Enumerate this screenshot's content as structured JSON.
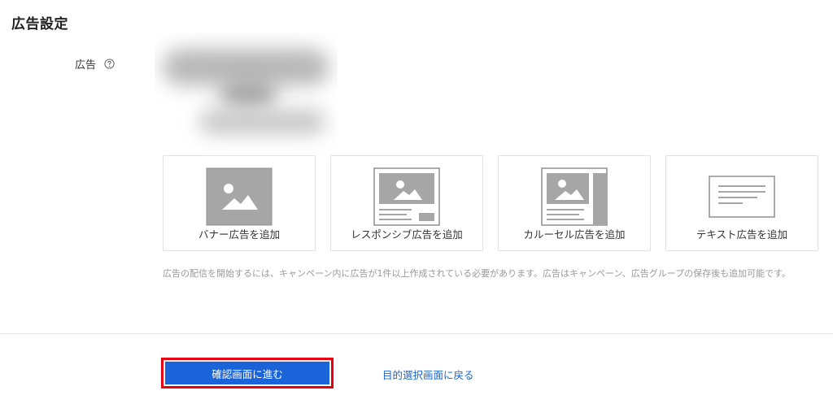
{
  "page": {
    "title": "広告設定"
  },
  "ad_field": {
    "label": "広告",
    "help_icon": "question-circle-icon"
  },
  "ad_types": [
    {
      "label": "バナー広告を追加",
      "icon": "banner-image-icon"
    },
    {
      "label": "レスポンシブ広告を追加",
      "icon": "responsive-ad-icon"
    },
    {
      "label": "カルーセル広告を追加",
      "icon": "carousel-ad-icon"
    },
    {
      "label": "テキスト広告を追加",
      "icon": "text-ad-icon"
    }
  ],
  "note": "広告の配信を開始するには、キャンペーン内に広告が1件以上作成されている必要があります。広告はキャンペーン、広告グループの保存後も追加可能です。",
  "actions": {
    "confirm_label": "確認画面に進む",
    "back_label": "目的選択画面に戻る"
  },
  "colors": {
    "accent": "#1a63d8",
    "highlight_border": "#e60012",
    "illustration_gray": "#a6a6a6"
  }
}
